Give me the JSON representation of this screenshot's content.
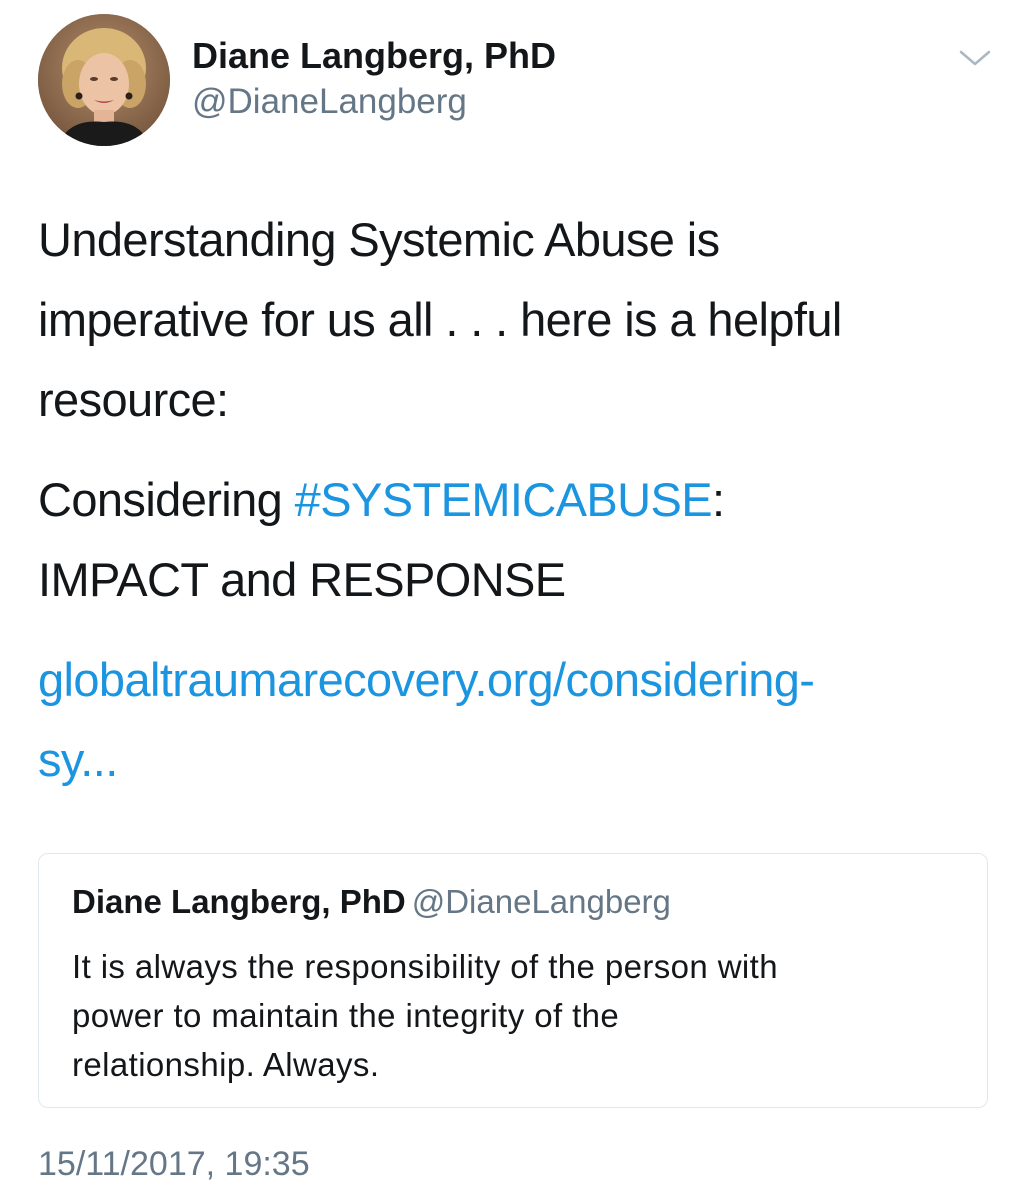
{
  "author": {
    "display_name": "Diane Langberg, PhD",
    "handle": "@DianeLangberg",
    "avatar": "profile-photo"
  },
  "menu": {
    "icon": "chevron-down-icon"
  },
  "tweet": {
    "line1": "Understanding Systemic Abuse is",
    "line2": "imperative for us all . . . here is a helpful",
    "line3": "resource:",
    "considering_prefix": "Considering ",
    "hashtag": "#SYSTEMICABUSE",
    "considering_suffix": ":",
    "considering_line2": "IMPACT and RESPONSE",
    "url_line1": "globaltraumarecovery.org/considering-",
    "url_line2": "sy..."
  },
  "quoted_tweet": {
    "display_name": "Diane Langberg, PhD",
    "handle": "@DianeLangberg",
    "text": "It is always the responsibility of the person with\npower to maintain the integrity of the\nrelationship.  Always."
  },
  "timestamp": "15/11/2017, 19:35",
  "colors": {
    "link": "#1b95e0",
    "text": "#14171a",
    "secondary": "#657786",
    "border": "#e1e8ed"
  }
}
